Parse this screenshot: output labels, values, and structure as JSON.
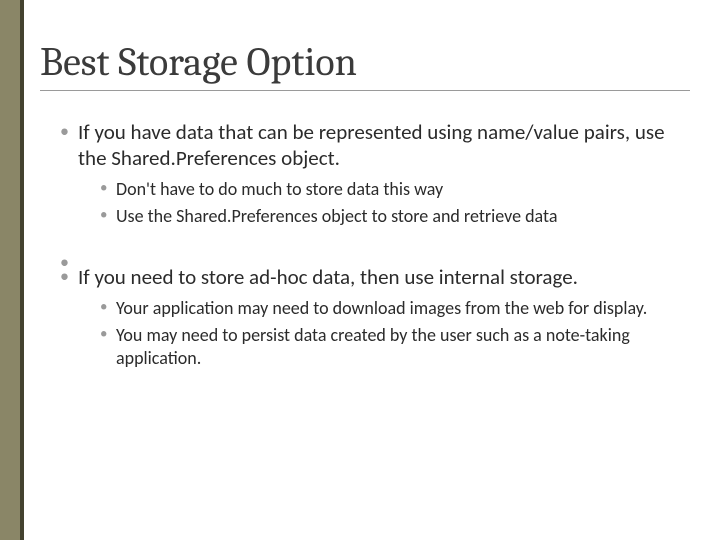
{
  "title": "Best Storage Option",
  "bullets": [
    {
      "text": "If you have data that can be represented using name/value pairs, use the Shared.Preferences object.",
      "sub": [
        "Don't have to do much to store data this way",
        "Use the Shared.Preferences object to store and retrieve data"
      ]
    },
    {
      "text": "If you need to store ad-hoc data, then use internal storage.",
      "sub": [
        "Your application may need to download images from the web for display.",
        "You may need to persist data created by the user such as a note-taking application."
      ]
    }
  ]
}
